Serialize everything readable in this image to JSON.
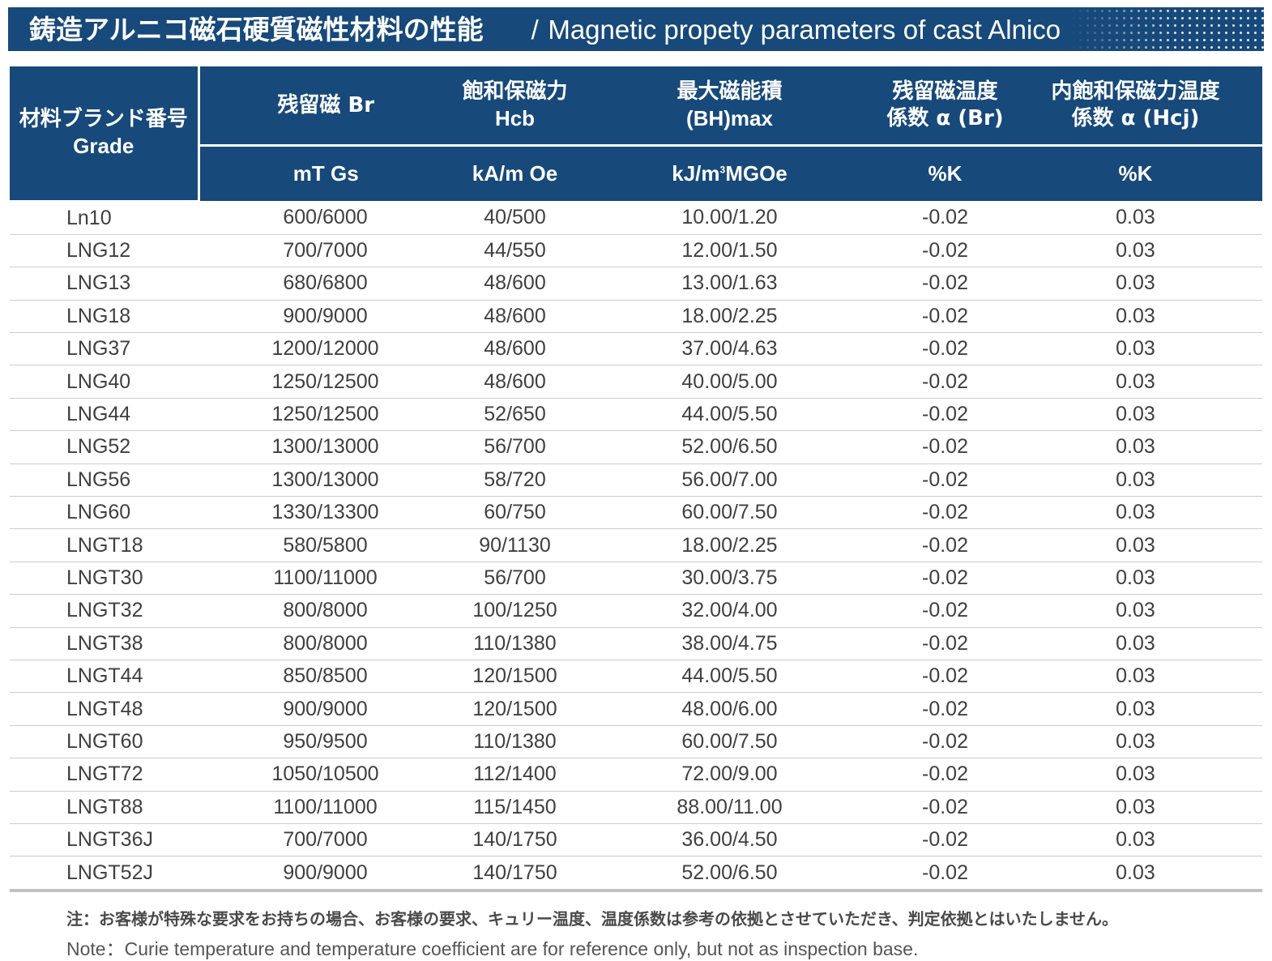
{
  "title": {
    "jp": "鋳造アルニコ磁石硬質磁性材料の性能",
    "separator": "/",
    "en": "Magnetic propety parameters of cast Alnico"
  },
  "header": {
    "grade": {
      "jp": "材料ブランド番号",
      "en": "Grade"
    },
    "br": {
      "label": "残留磁 Br",
      "unit": "mT Gs"
    },
    "hcb": {
      "label_jp": "飽和保磁力",
      "label_en": "Hcb",
      "unit": "kA/m Oe"
    },
    "bh": {
      "label_jp": "最大磁能積",
      "label_en": "(BH)max",
      "unit_a": "kJ/m",
      "unit_sup": "3",
      "unit_b": "MGOe"
    },
    "alpha_br": {
      "line1": "残留磁温度",
      "line2": "係数 α (Br)",
      "unit": "%K"
    },
    "alpha_hcj": {
      "line1": "内飽和保磁力温度",
      "line2": "係数 α (Hcj)",
      "unit": "%K"
    }
  },
  "rows": [
    {
      "grade": "Ln10",
      "br": "600/6000",
      "hcb": "40/500",
      "bh": "10.00/1.20",
      "a_br": "-0.02",
      "a_hcj": "0.03"
    },
    {
      "grade": "LNG12",
      "br": "700/7000",
      "hcb": "44/550",
      "bh": "12.00/1.50",
      "a_br": "-0.02",
      "a_hcj": "0.03"
    },
    {
      "grade": "LNG13",
      "br": "680/6800",
      "hcb": "48/600",
      "bh": "13.00/1.63",
      "a_br": "-0.02",
      "a_hcj": "0.03"
    },
    {
      "grade": "LNG18",
      "br": "900/9000",
      "hcb": "48/600",
      "bh": "18.00/2.25",
      "a_br": "-0.02",
      "a_hcj": "0.03"
    },
    {
      "grade": "LNG37",
      "br": "1200/12000",
      "hcb": "48/600",
      "bh": "37.00/4.63",
      "a_br": "-0.02",
      "a_hcj": "0.03"
    },
    {
      "grade": "LNG40",
      "br": "1250/12500",
      "hcb": "48/600",
      "bh": "40.00/5.00",
      "a_br": "-0.02",
      "a_hcj": "0.03"
    },
    {
      "grade": "LNG44",
      "br": "1250/12500",
      "hcb": "52/650",
      "bh": "44.00/5.50",
      "a_br": "-0.02",
      "a_hcj": "0.03"
    },
    {
      "grade": "LNG52",
      "br": "1300/13000",
      "hcb": "56/700",
      "bh": "52.00/6.50",
      "a_br": "-0.02",
      "a_hcj": "0.03"
    },
    {
      "grade": "LNG56",
      "br": "1300/13000",
      "hcb": "58/720",
      "bh": "56.00/7.00",
      "a_br": "-0.02",
      "a_hcj": "0.03"
    },
    {
      "grade": "LNG60",
      "br": "1330/13300",
      "hcb": "60/750",
      "bh": "60.00/7.50",
      "a_br": "-0.02",
      "a_hcj": "0.03"
    },
    {
      "grade": "LNGT18",
      "br": "580/5800",
      "hcb": "90/1130",
      "bh": "18.00/2.25",
      "a_br": "-0.02",
      "a_hcj": "0.03"
    },
    {
      "grade": "LNGT30",
      "br": "1100/11000",
      "hcb": "56/700",
      "bh": "30.00/3.75",
      "a_br": "-0.02",
      "a_hcj": "0.03"
    },
    {
      "grade": "LNGT32",
      "br": "800/8000",
      "hcb": "100/1250",
      "bh": "32.00/4.00",
      "a_br": "-0.02",
      "a_hcj": "0.03"
    },
    {
      "grade": "LNGT38",
      "br": "800/8000",
      "hcb": "110/1380",
      "bh": "38.00/4.75",
      "a_br": "-0.02",
      "a_hcj": "0.03"
    },
    {
      "grade": "LNGT44",
      "br": "850/8500",
      "hcb": "120/1500",
      "bh": "44.00/5.50",
      "a_br": "-0.02",
      "a_hcj": "0.03"
    },
    {
      "grade": "LNGT48",
      "br": "900/9000",
      "hcb": "120/1500",
      "bh": "48.00/6.00",
      "a_br": "-0.02",
      "a_hcj": "0.03"
    },
    {
      "grade": "LNGT60",
      "br": "950/9500",
      "hcb": "110/1380",
      "bh": "60.00/7.50",
      "a_br": "-0.02",
      "a_hcj": "0.03"
    },
    {
      "grade": "LNGT72",
      "br": "1050/10500",
      "hcb": "112/1400",
      "bh": "72.00/9.00",
      "a_br": "-0.02",
      "a_hcj": "0.03"
    },
    {
      "grade": "LNGT88",
      "br": "1100/11000",
      "hcb": "115/1450",
      "bh": "88.00/11.00",
      "a_br": "-0.02",
      "a_hcj": "0.03"
    },
    {
      "grade": "LNGT36J",
      "br": "700/7000",
      "hcb": "140/1750",
      "bh": "36.00/4.50",
      "a_br": "-0.02",
      "a_hcj": "0.03"
    },
    {
      "grade": "LNGT52J",
      "br": "900/9000",
      "hcb": "140/1750",
      "bh": "52.00/6.50",
      "a_br": "-0.02",
      "a_hcj": "0.03"
    }
  ],
  "notes": {
    "jp": "注：お客様が特殊な要求をお持ちの場合、お客様の要求、キュリー温度、温度係数は参考の依拠とさせていただき、判定依拠とはいたしません。",
    "en": "Note：Curie temperature and temperature coefficient are for reference only, but not as inspection base."
  },
  "colors": {
    "header_bg": "#17497a",
    "header_text": "#ffffff",
    "row_border": "#cdcdcd"
  }
}
